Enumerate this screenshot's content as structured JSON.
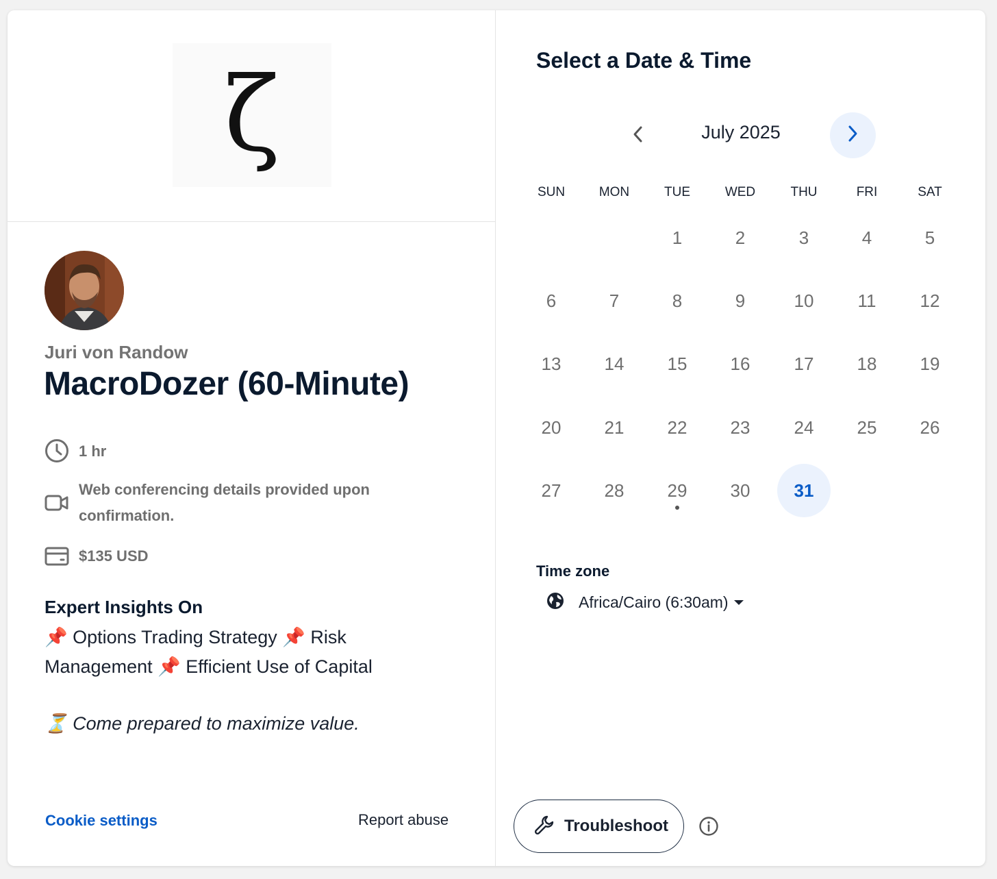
{
  "branding": {
    "logo_char": "ζ"
  },
  "host": {
    "name": "Juri von Randow"
  },
  "event": {
    "title": "MacroDozer (60-Minute)",
    "duration": "1 hr",
    "location": "Web conferencing details provided upon confirmation.",
    "price": "$135 USD",
    "description_heading": "Expert Insights On",
    "description_body": "📌 Options Trading Strategy 📌 Risk Management 📌 Efficient Use of Capital",
    "description_note": "⏳ Come prepared to maximize value."
  },
  "footer": {
    "cookie_label": "Cookie settings",
    "report_label": "Report abuse"
  },
  "calendar": {
    "title": "Select a Date & Time",
    "month_label": "July 2025",
    "weekdays": [
      "SUN",
      "MON",
      "TUE",
      "WED",
      "THU",
      "FRI",
      "SAT"
    ],
    "first_weekday_index": 2,
    "days_in_month": 31,
    "available_days": [
      31
    ],
    "today_marker_day": 29
  },
  "timezone": {
    "label": "Time zone",
    "value": "Africa/Cairo (6:30am)"
  },
  "troubleshoot": {
    "label": "Troubleshoot"
  },
  "colors": {
    "accent": "#0a5cc7",
    "available_bg": "#ebf2fd",
    "heading": "#0b1a2e"
  },
  "icons": [
    "clock-icon",
    "video-camera-icon",
    "wallet-icon",
    "chevron-left-icon",
    "chevron-right-icon",
    "globe-icon",
    "wrench-icon",
    "info-icon"
  ]
}
